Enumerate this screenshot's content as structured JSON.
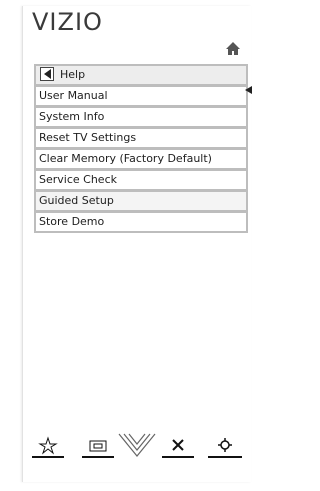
{
  "header": {
    "logo_text": "VIZIO",
    "home_icon": "home-icon"
  },
  "menu": {
    "title": "Help",
    "back_icon": "back-arrow-icon",
    "items": [
      {
        "label": "User Manual"
      },
      {
        "label": "System Info"
      },
      {
        "label": "Reset TV Settings"
      },
      {
        "label": "Clear Memory (Factory Default)"
      },
      {
        "label": "Service Check"
      },
      {
        "label": "Guided Setup"
      },
      {
        "label": "Store Demo"
      }
    ]
  },
  "bottom_bar": {
    "icons": [
      "star-icon",
      "aspect-ratio-icon",
      "vizio-v-icon",
      "close-icon",
      "settings-gear-icon"
    ]
  },
  "colors": {
    "border": "#bdbdbd",
    "header_bg": "#ededed",
    "text": "#1e1e1e"
  }
}
